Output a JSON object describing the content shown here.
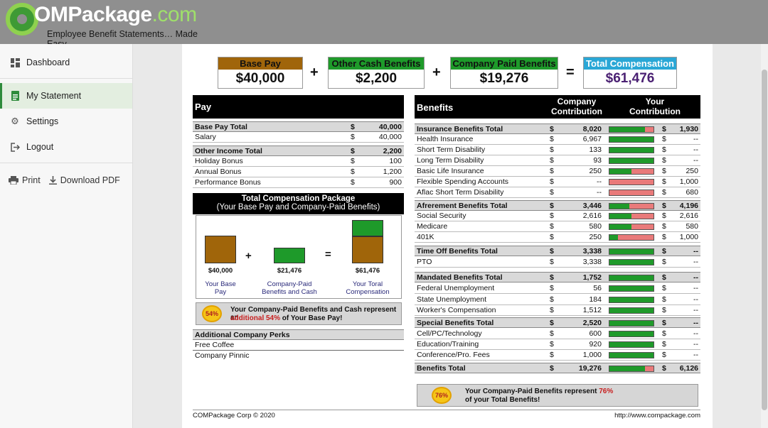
{
  "header": {
    "logo_c": "C",
    "logo_bold": "OMPackage",
    "logo_com": ".com",
    "tagline": "Employee Benefit Statements… Made Easy"
  },
  "sidebar": {
    "items": [
      {
        "label": "Dashboard",
        "icon": "dashboard-icon"
      },
      {
        "label": "My Statement",
        "icon": "statement-icon",
        "active": true
      },
      {
        "label": "Settings",
        "icon": "gear-icon"
      },
      {
        "label": "Logout",
        "icon": "logout-icon"
      }
    ],
    "print_label": "Print",
    "download_label": "Download PDF"
  },
  "summary": {
    "base_pay_label": "Base Pay",
    "base_pay_value": "$40,000",
    "other_cash_label": "Other Cash Benefits",
    "other_cash_value": "$2,200",
    "company_paid_label": "Company Paid Benefits",
    "company_paid_value": "$19,276",
    "total_label": "Total Compensation",
    "total_value": "$61,476",
    "plus": "+",
    "equals": "="
  },
  "colors": {
    "base_pay": "#a0650a",
    "other_cash": "#1e9a2a",
    "company_paid": "#1e9a2a",
    "total": "#2aa7d6",
    "total_value": "#4b2173"
  },
  "pay": {
    "title": "Pay",
    "rows": [
      {
        "label": "Base Pay Total",
        "cur": "$",
        "value": "40,000",
        "total": true
      },
      {
        "label": "Salary",
        "cur": "$",
        "value": "40,000"
      },
      {
        "label": "Other Income Total",
        "cur": "$",
        "value": "2,200",
        "total": true
      },
      {
        "label": "Holiday Bonus",
        "cur": "$",
        "value": "100"
      },
      {
        "label": "Annual Bonus",
        "cur": "$",
        "value": "1,200"
      },
      {
        "label": "Performance Bonus",
        "cur": "$",
        "value": "900"
      }
    ]
  },
  "package": {
    "title": "Total Compensation Package",
    "subtitle": "(Your Base Pay and Company-Paid Benefits)",
    "base_value": "$40,000",
    "base_caption": "Your Base Pay",
    "company_value": "$21,476",
    "company_caption": "Company-Paid Benefits and Cash",
    "total_value": "$61,476",
    "total_caption": "Your Toral Compensation",
    "plus": "+",
    "equals": "="
  },
  "note1": {
    "badge": "54%",
    "line1": "Your Company-Paid Benefits and Cash represent an",
    "line2_red": "additional 54%",
    "line2": " of Your Base Pay!"
  },
  "perks": {
    "title": "Additional Company Perks",
    "items": [
      "Free Coffee",
      "Company Pinnic"
    ]
  },
  "benefits": {
    "title": "Benefits",
    "company_col": "Company Contribution",
    "your_col": "Your Contribution",
    "rows": [
      {
        "label": "Insurance Benefits Total",
        "cv": "8,020",
        "share": 0.8,
        "yv": "1,930",
        "total": true
      },
      {
        "label": "Health Insurance",
        "cv": "6,967",
        "share": 1.0,
        "yv": "--"
      },
      {
        "label": "Short Term Disability",
        "cv": "133",
        "share": 1.0,
        "yv": "--"
      },
      {
        "label": "Long Term Disability",
        "cv": "93",
        "share": 1.0,
        "yv": "--"
      },
      {
        "label": "Basic Life Insurance",
        "cv": "250",
        "share": 0.5,
        "yv": "250"
      },
      {
        "label": "Flexible Spending Accounts",
        "cv": "--",
        "share": 0.0,
        "yv": "1,000"
      },
      {
        "label": "Aflac Short Term Disability",
        "cv": "--",
        "share": 0.0,
        "yv": "680"
      },
      {
        "label": "Afrerement Benefits Total",
        "cv": "3,446",
        "share": 0.45,
        "yv": "4,196",
        "total": true
      },
      {
        "label": "Social Security",
        "cv": "2,616",
        "share": 0.5,
        "yv": "2,616"
      },
      {
        "label": "Medicare",
        "cv": "580",
        "share": 0.5,
        "yv": "580"
      },
      {
        "label": "401K",
        "cv": "250",
        "share": 0.2,
        "yv": "1,000"
      },
      {
        "label": "Time Off Benefits Total",
        "cv": "3,338",
        "share": 1.0,
        "yv": "--",
        "total": true
      },
      {
        "label": "PTO",
        "cv": "3,338",
        "share": 1.0,
        "yv": "--"
      },
      {
        "label": "Mandated Benefits Total",
        "cv": "1,752",
        "share": 1.0,
        "yv": "--",
        "total": true
      },
      {
        "label": "Federal Unemployment",
        "cv": "56",
        "share": 1.0,
        "yv": "--"
      },
      {
        "label": "State Unemployment",
        "cv": "184",
        "share": 1.0,
        "yv": "--"
      },
      {
        "label": "Worker's Compensation",
        "cv": "1,512",
        "share": 1.0,
        "yv": "--"
      },
      {
        "label": "Special Benefits Total",
        "cv": "2,520",
        "share": 1.0,
        "yv": "--",
        "total": true
      },
      {
        "label": "Cell/PC/Technology",
        "cv": "600",
        "share": 1.0,
        "yv": "--"
      },
      {
        "label": "Education/Training",
        "cv": "920",
        "share": 1.0,
        "yv": "--"
      },
      {
        "label": "Conference/Pro. Fees",
        "cv": "1,000",
        "share": 1.0,
        "yv": "--"
      },
      {
        "label": "Benefits Total",
        "cv": "19,276",
        "share": 0.8,
        "yv": "6,126",
        "total": true
      }
    ]
  },
  "note2": {
    "badge": "76%",
    "line1": "Your Company-Paid Benefits represent ",
    "line1_red": "76%",
    "line2": "of your Total Benefits!"
  },
  "footer": {
    "left": "COMPackage Corp © 2020",
    "right": "http://www.compackage.com"
  }
}
